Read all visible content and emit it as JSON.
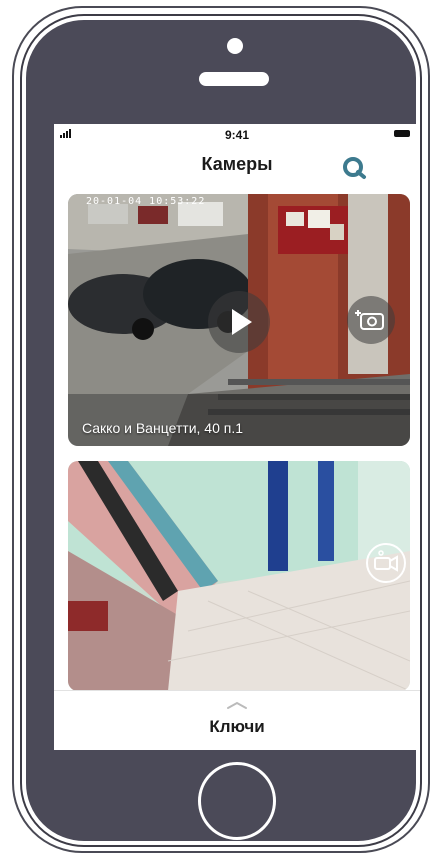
{
  "status_bar": {
    "time": "9:41"
  },
  "header": {
    "title": "Камеры",
    "search_icon": "search-icon"
  },
  "cameras": [
    {
      "overlay_timestamp": "20-01-04 10:53:22",
      "caption": "Сакко и Ванцетти, 40 п.1",
      "play_icon": "play-icon",
      "snapshot_icon": "camera-snapshot-icon"
    },
    {
      "video_icon": "video-camera-icon"
    }
  ],
  "bottom_sheet": {
    "title": "Ключи",
    "handle_icon": "chevron-up-icon"
  },
  "colors": {
    "phone_body": "#4b4a58",
    "accent": "#3d7a8e",
    "screen_bg": "#ffffff"
  }
}
